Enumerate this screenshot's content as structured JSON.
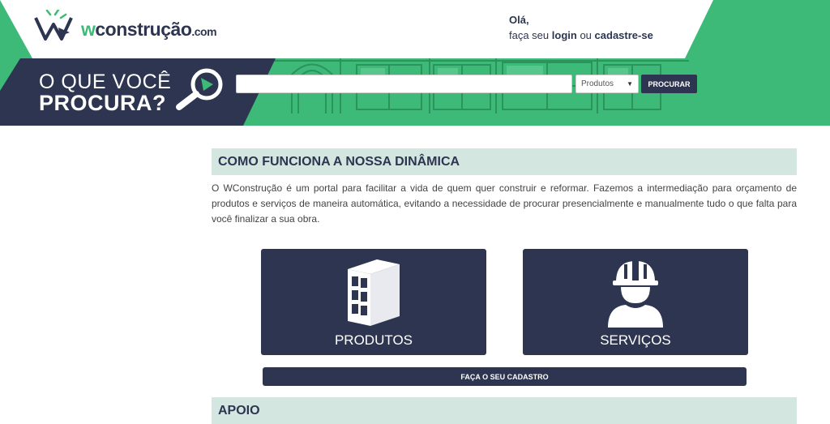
{
  "brand": {
    "logo_w": "w",
    "logo_main": "construção",
    "logo_domain": ".com"
  },
  "greeting": {
    "hello": "Olá,",
    "prefix": "faça seu",
    "login": "login",
    "or": "ou",
    "signup": "cadastre-se"
  },
  "search": {
    "question_line1": "O QUE VOCÊ",
    "question_line2": "PROCURA?",
    "input_value": "",
    "input_placeholder": "",
    "category_selected": "Produtos",
    "button_label": "PROCURAR"
  },
  "how_it_works": {
    "title": "COMO FUNCIONA A NOSSA DINÂMICA",
    "text": "O WConstrução é um portal para facilitar a vida de quem quer construir e reformar. Fazemos a intermediação para orçamento de produtos e serviços de maneira automática, evitando a necessidade de procurar presencialmente e manualmente tudo o que falta para você finalizar a sua obra."
  },
  "cards": [
    {
      "label": "PRODUTOS",
      "icon": "brick-icon"
    },
    {
      "label": "SERVIÇOS",
      "icon": "worker-helmet-icon"
    }
  ],
  "cadastro_button": "FAÇA O SEU CADASTRO",
  "support": {
    "title": "APOIO"
  },
  "colors": {
    "navy": "#2d3550",
    "green": "#3dba78",
    "section_bg": "#d4e6e0"
  }
}
